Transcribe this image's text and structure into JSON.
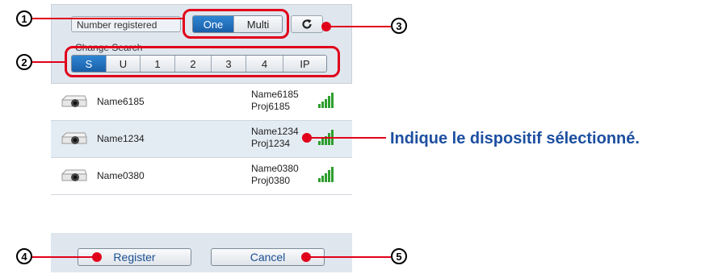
{
  "header": {
    "number_registered_label": "Number registered",
    "mode_options": [
      "One",
      "Multi"
    ],
    "mode_selected": "One",
    "refresh_icon": "refresh-icon"
  },
  "search": {
    "label": "Change Search",
    "options": [
      "S",
      "U",
      "1",
      "2",
      "3",
      "4",
      "IP"
    ],
    "selected": "S"
  },
  "devices": [
    {
      "name": "Name6185",
      "display_name": "Name6185",
      "project": "Proj6185",
      "selected": false
    },
    {
      "name": "Name1234",
      "display_name": "Name1234",
      "project": "Proj1234",
      "selected": true
    },
    {
      "name": "Name0380",
      "display_name": "Name0380",
      "project": "Proj0380",
      "selected": false
    }
  ],
  "footer": {
    "register_label": "Register",
    "cancel_label": "Cancel"
  },
  "callouts": [
    "1",
    "2",
    "3",
    "4",
    "5"
  ],
  "annotation_text": "Indique le dispositif sélectionné.",
  "colors": {
    "highlight": "#e1001a",
    "active_button": "#1a6fc0",
    "annotation": "#1d4fa0"
  }
}
